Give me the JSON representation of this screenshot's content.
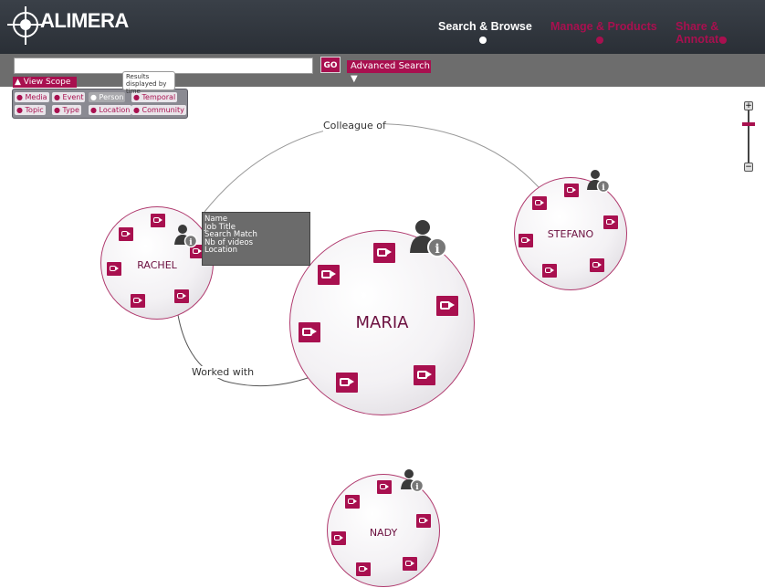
{
  "app": {
    "logo_text": "ALIMERA"
  },
  "nav": {
    "items": [
      {
        "label": "Search & Browse",
        "color": "#ffffff"
      },
      {
        "label": "Manage & Products",
        "color": "#a8104f"
      },
      {
        "label": "Share & Annotate",
        "color": "#a8104f"
      }
    ]
  },
  "search": {
    "value": "",
    "placeholder": "",
    "go_label": "GO",
    "advanced_label": "Advanced Search ▼",
    "view_scope_label": "▲ View Scope"
  },
  "filters": {
    "tooltip": "Results displayed by time",
    "row1": [
      "Media",
      "Event",
      "Person",
      "Temporal"
    ],
    "row2": [
      "Topic",
      "Type",
      "Location",
      "Community"
    ],
    "active": "Person"
  },
  "info_card": {
    "lines": [
      "Name",
      "Job Title",
      "Search Match",
      "Nb of videos",
      "Location"
    ]
  },
  "people": {
    "maria": "MARIA",
    "rachel": "RACHEL",
    "stefano": "STEFANO",
    "nady": "NADY"
  },
  "edges": {
    "colleague": "Colleague of",
    "worked": "Worked with"
  },
  "zoom": {
    "plus": "+",
    "minus": "−",
    "level": 0.25
  },
  "colors": {
    "accent": "#a8104f",
    "header": "#2f343b",
    "toolbar": "#6d6d6d"
  }
}
